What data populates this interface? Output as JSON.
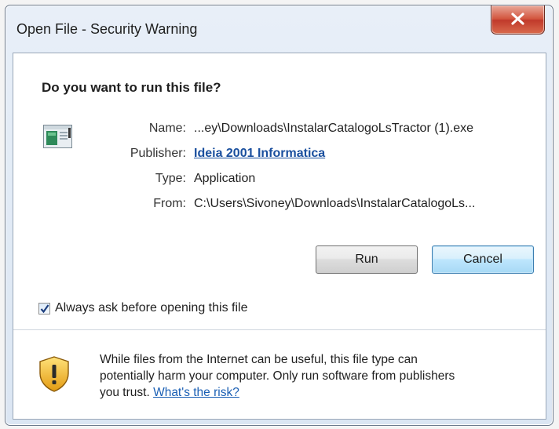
{
  "window": {
    "title": "Open File - Security Warning",
    "close_label": "close"
  },
  "dialog": {
    "heading": "Do you want to run this file?",
    "fields": [
      {
        "label": "Name:",
        "value": "...ey\\Downloads\\InstalarCatalogoLsTractor (1).exe"
      },
      {
        "label": "Publisher:",
        "value": "Ideia 2001 Informatica"
      },
      {
        "label": "Type:",
        "value": "Application"
      },
      {
        "label": "From:",
        "value": "C:\\Users\\Sivoney\\Downloads\\InstalarCatalogoLs..."
      }
    ],
    "buttons": {
      "run": "Run",
      "cancel": "Cancel"
    },
    "checkbox": {
      "label": "Always ask before opening this file",
      "checked": true
    },
    "warning": {
      "text_line1": "While files from the Internet can be useful, this file type can",
      "text_line2": "potentially harm your computer. Only run software from publishers",
      "text_line3": "you trust.",
      "link": "What's the risk?"
    }
  },
  "icons": {
    "file": "application-file-icon",
    "shield": "shield-warning-icon",
    "close": "close-icon",
    "check": "check-icon"
  },
  "colors": {
    "link": "#1a4f9e",
    "close_button": "#c0392b",
    "default_button": "#bee6fd"
  }
}
